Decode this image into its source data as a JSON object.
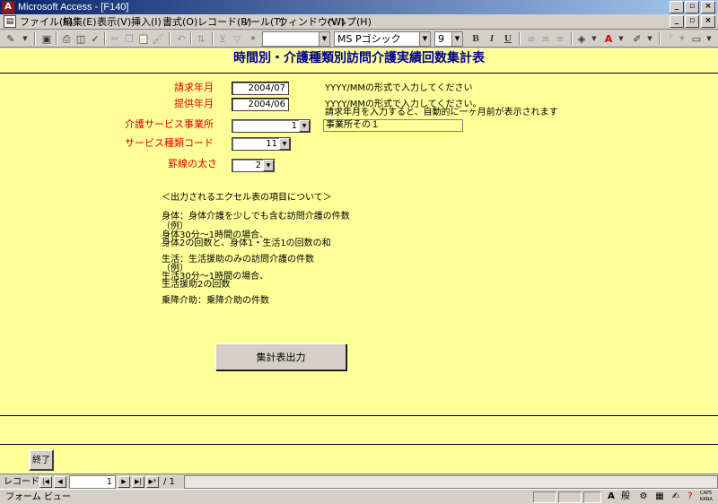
{
  "window": {
    "title": "Microsoft Access - [F140]",
    "minimize": "_",
    "restore": "▫",
    "close": "×"
  },
  "menu": {
    "items": [
      {
        "label": "ファイル(F)"
      },
      {
        "label": "編集(E)"
      },
      {
        "label": "表示(V)"
      },
      {
        "label": "挿入(I)"
      },
      {
        "label": "書式(O)"
      },
      {
        "label": "レコード(R)"
      },
      {
        "label": "ツール(T)"
      },
      {
        "label": "ウィンドウ(W)"
      },
      {
        "label": "ヘルプ(H)"
      }
    ]
  },
  "toolbar": {
    "font_name": "MS Pゴシック",
    "font_size": "9",
    "bold": "B",
    "italic": "I",
    "underline": "U"
  },
  "form": {
    "title": "時間別・介護種類別訪問介護実績回数集計表",
    "billing_month": {
      "label": "請求年月",
      "value": "2004/07",
      "note": "YYYY/MMの形式で入力してください"
    },
    "service_month": {
      "label": "提供年月",
      "value": "2004/06",
      "note1": "YYYY/MMの形式で入力してください。",
      "note2": "請求年月を入力すると、自動的に一ヶ月前が表示されます"
    },
    "office": {
      "label": "介護サービス事業所",
      "value": "1",
      "name": "事業所その１"
    },
    "service_code": {
      "label": "サービス種類コード",
      "value": "11"
    },
    "line_width": {
      "label": "罫線の太さ",
      "value": "2"
    },
    "info": {
      "heading": "＜出力されるエクセル表の項目について＞",
      "body1": "身体：身体介護を少しでも含む訪問介護の件数",
      "body2": "（例）",
      "body3": "身体30分～1時間の場合、",
      "body4": "身体2の回数と、身体1・生活1の回数の和",
      "life1": "生活：生活援助のみの訪問介護の件数",
      "life2": "（例）",
      "life3": "生活30分～1時間の場合、",
      "life4": "生活援助2の回数",
      "transfer": "乗降介助：乗降介助の件数"
    },
    "output_button": "集計表出力",
    "exit_button": "終了"
  },
  "record_nav": {
    "label": "レコード:",
    "current": "1",
    "total": "/ 1"
  },
  "status": {
    "text": "フォーム ビュー",
    "ime": "般",
    "caps": "CAPS",
    "kana": "KANA"
  }
}
